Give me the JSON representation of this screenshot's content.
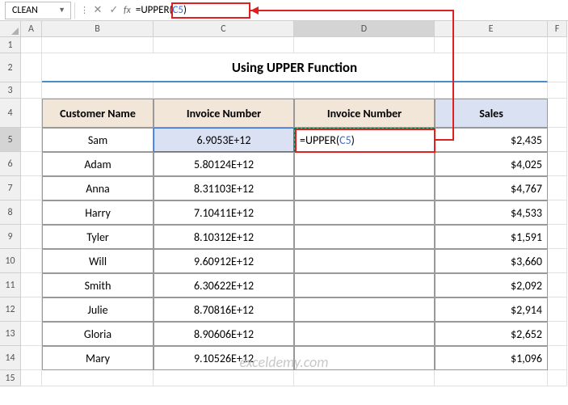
{
  "name_box": "CLEAN",
  "formula_prefix": "=UPPER(",
  "formula_ref": "C5",
  "formula_suffix": ")",
  "title": "Using UPPER Function",
  "headers": {
    "customer": "Customer Name",
    "invoice1": "Invoice Number",
    "invoice2": "Invoice Number",
    "sales": "Sales"
  },
  "editing_prefix": "=UPPER(",
  "editing_ref": "C5",
  "editing_suffix": ")",
  "columns": [
    "A",
    "B",
    "C",
    "D",
    "E",
    "F"
  ],
  "row_nums": [
    "1",
    "2",
    "3",
    "4",
    "5",
    "6",
    "7",
    "8",
    "9",
    "10",
    "11",
    "12",
    "13",
    "14",
    "15"
  ],
  "rows": [
    {
      "name": "Sam",
      "invoice": "6.9053E+12",
      "sales": "$2,435"
    },
    {
      "name": "Adam",
      "invoice": "5.80124E+12",
      "sales": "$4,025"
    },
    {
      "name": "Anna",
      "invoice": "8.31103E+12",
      "sales": "$4,767"
    },
    {
      "name": "Harry",
      "invoice": "7.10411E+12",
      "sales": "$4,533"
    },
    {
      "name": "Tyler",
      "invoice": "8.10312E+12",
      "sales": "$1,591"
    },
    {
      "name": "Will",
      "invoice": "9.60912E+12",
      "sales": "$3,660"
    },
    {
      "name": "Smith",
      "invoice": "6.30622E+12",
      "sales": "$2,092"
    },
    {
      "name": "Julie",
      "invoice": "8.70816E+12",
      "sales": "$2,914"
    },
    {
      "name": "Gloria",
      "invoice": "8.90606E+12",
      "sales": "$2,652"
    },
    {
      "name": "Mary",
      "invoice": "9.10526E+12",
      "sales": "$1,096"
    }
  ],
  "watermark": "exceldemy.com",
  "chart_data": {
    "type": "table",
    "title": "Using UPPER Function",
    "columns": [
      "Customer Name",
      "Invoice Number",
      "Invoice Number",
      "Sales"
    ],
    "rows": [
      [
        "Sam",
        "6.9053E+12",
        "=UPPER(C5)",
        2435
      ],
      [
        "Adam",
        "5.80124E+12",
        "",
        4025
      ],
      [
        "Anna",
        "8.31103E+12",
        "",
        4767
      ],
      [
        "Harry",
        "7.10411E+12",
        "",
        4533
      ],
      [
        "Tyler",
        "8.10312E+12",
        "",
        1591
      ],
      [
        "Will",
        "9.60912E+12",
        "",
        3660
      ],
      [
        "Smith",
        "6.30622E+12",
        "",
        2092
      ],
      [
        "Julie",
        "8.70816E+12",
        "",
        2914
      ],
      [
        "Gloria",
        "8.90606E+12",
        "",
        2652
      ],
      [
        "Mary",
        "9.10526E+12",
        "",
        1096
      ]
    ]
  }
}
